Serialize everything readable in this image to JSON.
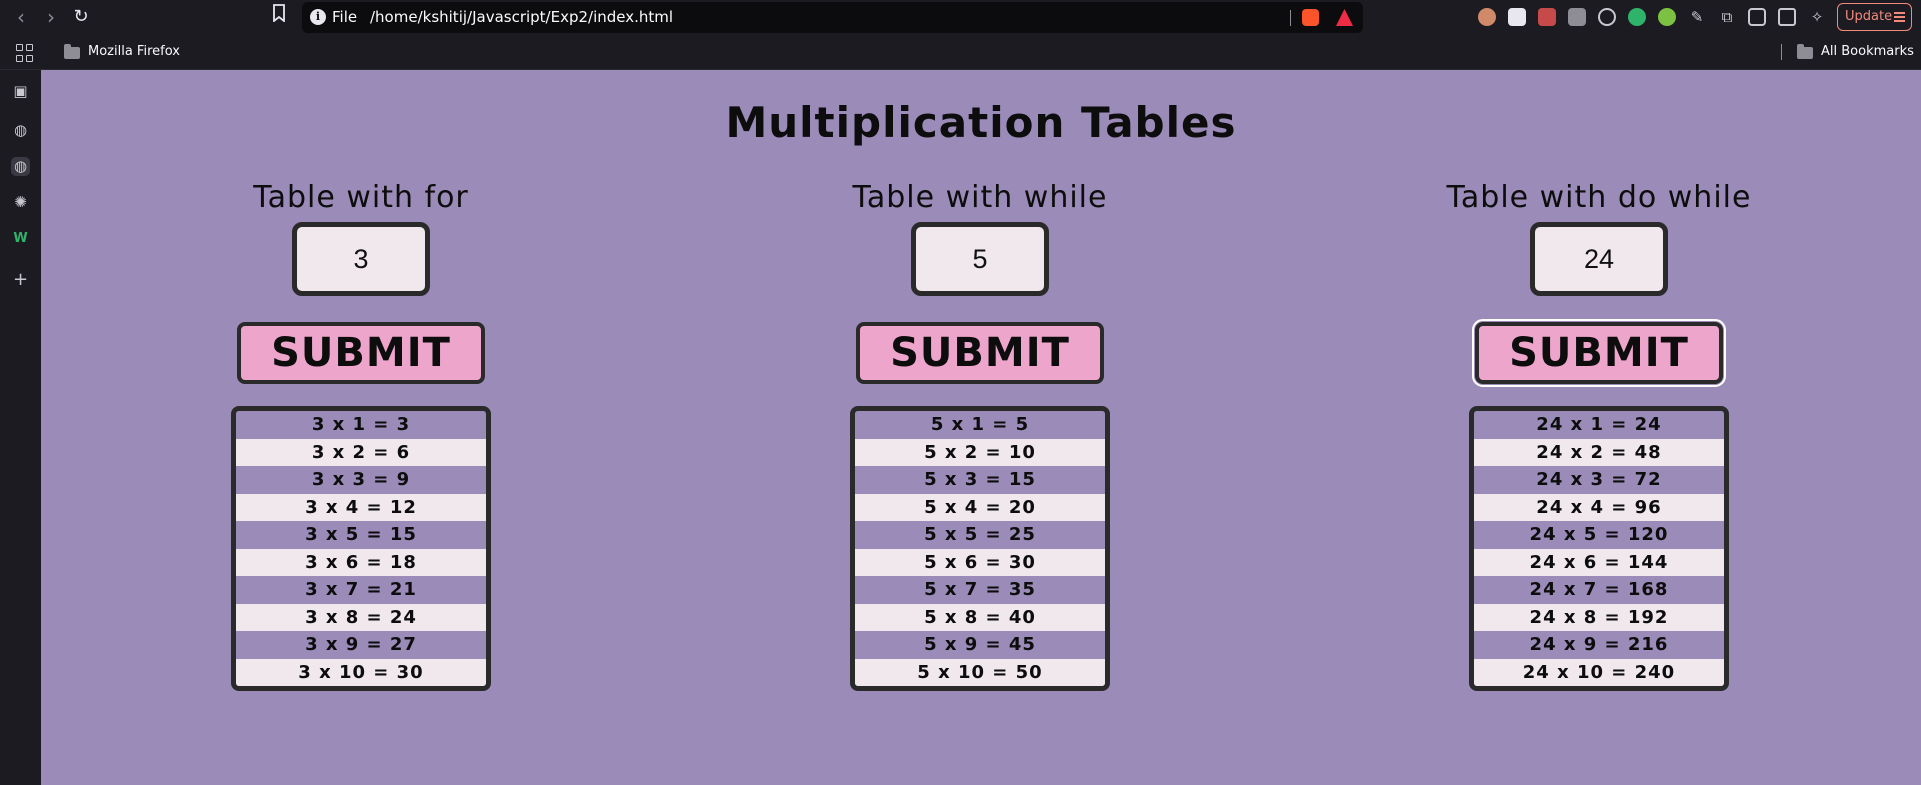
{
  "browser": {
    "url_label": "File",
    "url_path": "/home/kshitij/Javascript/Exp2/index.html",
    "update_label": "Update",
    "bookmarks": [
      "Mozilla Firefox"
    ],
    "all_bookmarks_label": "All Bookmarks"
  },
  "page": {
    "title": "Multiplication Tables",
    "columns": [
      {
        "title": "Table with for",
        "input_value": "3",
        "submit_label": "SUBMIT",
        "rows": [
          "3 x 1 = 3",
          "3 x 2 = 6",
          "3 x 3 = 9",
          "3 x 4 = 12",
          "3 x 5 = 15",
          "3 x 6 = 18",
          "3 x 7 = 21",
          "3 x 8 = 24",
          "3 x 9 = 27",
          "3 x 10 = 30"
        ]
      },
      {
        "title": "Table with while",
        "input_value": "5",
        "submit_label": "SUBMIT",
        "rows": [
          "5 x 1 = 5",
          "5 x 2 = 10",
          "5 x 3 = 15",
          "5 x 4 = 20",
          "5 x 5 = 25",
          "5 x 6 = 30",
          "5 x 7 = 35",
          "5 x 8 = 40",
          "5 x 9 = 45",
          "5 x 10 = 50"
        ]
      },
      {
        "title": "Table with do while",
        "input_value": "24",
        "submit_label": "SUBMIT",
        "rows": [
          "24 x 1 = 24",
          "24 x 2 = 48",
          "24 x 3 = 72",
          "24 x 4 = 96",
          "24 x 5 = 120",
          "24 x 6 = 144",
          "24 x 7 = 168",
          "24 x 8 = 192",
          "24 x 9 = 216",
          "24 x 10 = 240"
        ]
      }
    ]
  },
  "colors": {
    "page_background": "#9b8bb9",
    "row_light": "#f1e8ee",
    "submit_background": "#eea5cc",
    "border": "#2a2a2a"
  }
}
